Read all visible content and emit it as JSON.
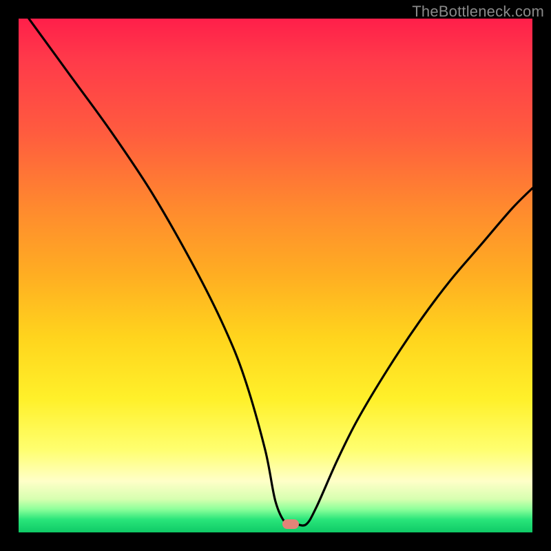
{
  "watermark": "TheBottleneck.com",
  "chart_data": {
    "type": "line",
    "title": "",
    "xlabel": "",
    "ylabel": "",
    "xlim": [
      0,
      100
    ],
    "ylim": [
      0,
      100
    ],
    "grid": false,
    "series": [
      {
        "name": "bottleneck-curve",
        "x": [
          2,
          10,
          18,
          26,
          34,
          40,
          44,
          48,
          50,
          52,
          54,
          56,
          58,
          62,
          66,
          72,
          78,
          84,
          90,
          96,
          100
        ],
        "values": [
          100,
          89,
          78,
          66,
          52,
          40,
          30,
          16,
          6,
          1.8,
          1.6,
          1.6,
          5,
          14,
          22,
          32,
          41,
          49,
          56,
          63,
          67
        ]
      }
    ],
    "marker": {
      "x": 53,
      "y": 1.6,
      "color": "#e28478"
    },
    "background_gradient": {
      "stops": [
        {
          "pos": 0,
          "color": "#ff1f4a"
        },
        {
          "pos": 0.22,
          "color": "#ff5b3f"
        },
        {
          "pos": 0.5,
          "color": "#ffae22"
        },
        {
          "pos": 0.74,
          "color": "#fff02a"
        },
        {
          "pos": 0.9,
          "color": "#ffffc8"
        },
        {
          "pos": 0.97,
          "color": "#29e57a"
        },
        {
          "pos": 1.0,
          "color": "#0fca66"
        }
      ]
    }
  }
}
